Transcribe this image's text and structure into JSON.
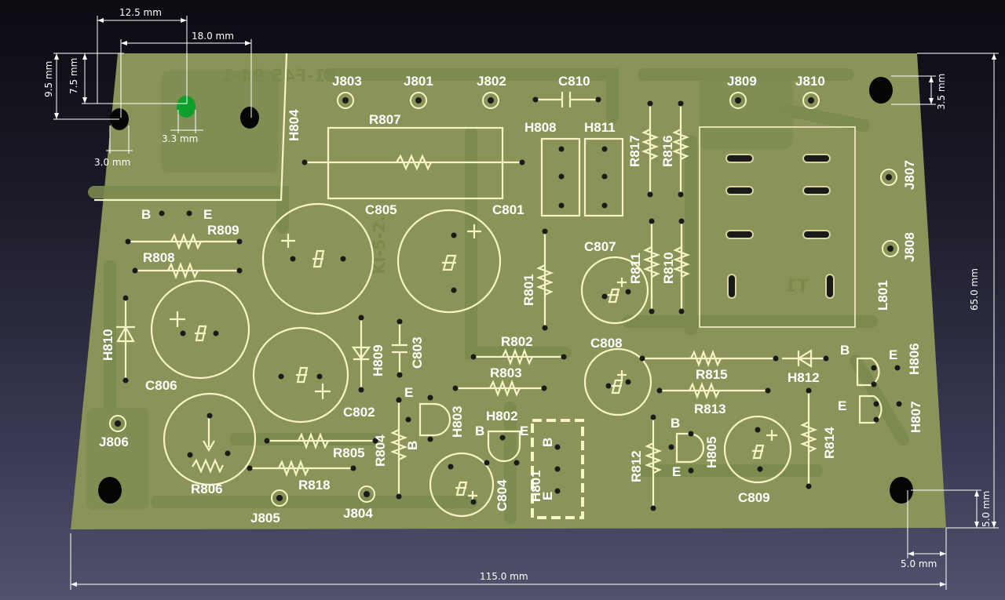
{
  "dimensions": {
    "w_12_5": "12.5 mm",
    "w_18_0": "18.0 mm",
    "h_9_5": "9.5 mm",
    "h_7_5": "7.5 mm",
    "hole_3_3": "3.3 mm",
    "hole_3_0": "3.0 mm",
    "right_3_5": "3.5 mm",
    "height_65": "65.0 mm",
    "right_5_0": "5.0 mm",
    "bottom_5_0": "5.0 mm",
    "width_115": "115.0 mm"
  },
  "components": {
    "J803": "J803",
    "J801": "J801",
    "J802": "J802",
    "C810": "C810",
    "J809": "J809",
    "J810": "J810",
    "H804": "H804",
    "R807": "R807",
    "H808": "H808",
    "H811": "H811",
    "R817": "R817",
    "R816": "R816",
    "J807": "J807",
    "J808": "J808",
    "B1": "B",
    "E1": "E",
    "R809": "R809",
    "R808": "R808",
    "C805": "C805",
    "C801": "C801",
    "C807": "C807",
    "R811": "R811",
    "R810": "R810",
    "L801": "L801",
    "R801": "R801",
    "H810": "H810",
    "C806": "C806",
    "H809": "H809",
    "C803": "C803",
    "R802": "R802",
    "R803": "R803",
    "C808": "C808",
    "R815": "R815",
    "H812": "H812",
    "B2": "B",
    "E2": "E",
    "H806": "H806",
    "R813": "R813",
    "E3": "E",
    "H807": "H807",
    "C802": "C802",
    "J806": "J806",
    "E4": "E",
    "H803": "H803",
    "H802": "H802",
    "B3": "B",
    "E5": "E",
    "B4": "B",
    "R805": "R805",
    "R804": "R804",
    "B5": "B",
    "H801": "H801",
    "R812": "R812",
    "B6": "B",
    "H805": "H805",
    "E6": "E",
    "R814": "R814",
    "C809": "C809",
    "R806": "R806",
    "R818": "R818",
    "C804": "C804",
    "J805": "J805",
    "J804": "J804",
    "E7": "E",
    "B7": "B"
  },
  "mirrored_text": {
    "top": "E1-F45 94-1",
    "mid": "KI-5-2.0",
    "right": "T1"
  }
}
